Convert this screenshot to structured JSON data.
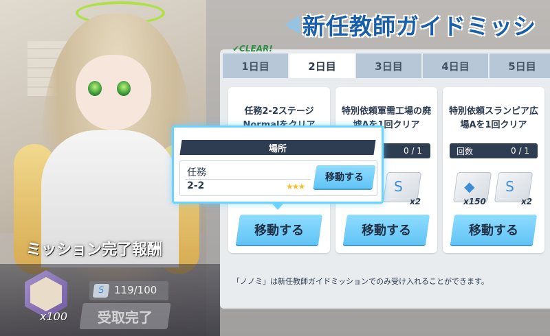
{
  "header": {
    "title": "新任教師ガイドミッシ"
  },
  "clear_badge": "✔CLEAR!",
  "tabs": [
    {
      "label": "1日目"
    },
    {
      "label": "2日目",
      "active": true
    },
    {
      "label": "3日目"
    },
    {
      "label": "4日目"
    },
    {
      "label": "5日目"
    }
  ],
  "missions": [
    {
      "title": "任務2-2ステージNormalをクリア",
      "button": "移動する"
    },
    {
      "title": "特別依頼軍需工場の廃墟Aを1回クリア",
      "count": "0 / 1",
      "reward_qty": "x2",
      "button": "移動する"
    },
    {
      "title": "特別依頼スランピア広場Aを1回クリア",
      "count_label": "回数",
      "count": "0 / 1",
      "reward1_qty": "x150",
      "reward2_qty": "x2",
      "button": "移動する"
    }
  ],
  "popup": {
    "header": "場所",
    "category": "任務",
    "stage": "2-2",
    "stars": "★★★",
    "button": "移動する"
  },
  "notice": "「ノノミ」は新任教師ガイドミッションでのみ受け入れることができます。",
  "reward": {
    "title": "ミッション完了報酬",
    "item_qty": "x100",
    "progress": "119/100",
    "claim_button": "受取完了"
  },
  "colors": {
    "accent": "#61c4f5",
    "title": "#1a5fa8",
    "dark_bar": "#2f3d52",
    "star": "#f2c12e"
  }
}
